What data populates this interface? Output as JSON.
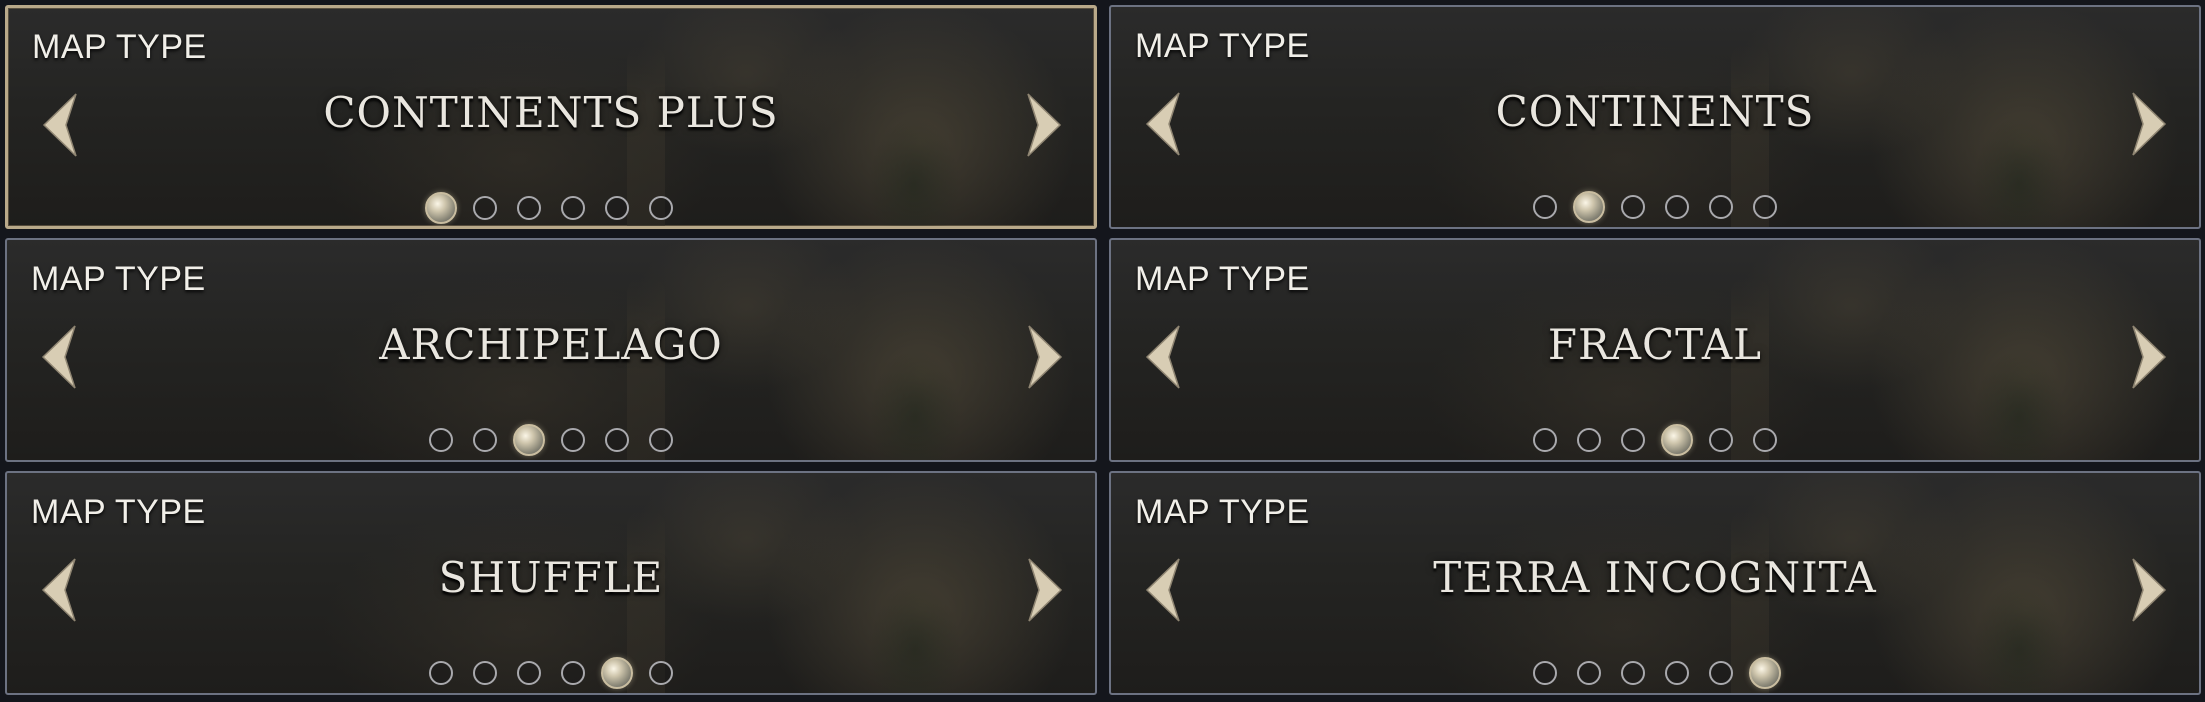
{
  "panels": [
    {
      "label": "MAP TYPE",
      "value": "CONTINENTS PLUS",
      "selected": true,
      "active_index": 0,
      "option_count": 6
    },
    {
      "label": "MAP TYPE",
      "value": "CONTINENTS",
      "selected": false,
      "active_index": 1,
      "option_count": 6
    },
    {
      "label": "MAP TYPE",
      "value": "ARCHIPELAGO",
      "selected": false,
      "active_index": 2,
      "option_count": 6
    },
    {
      "label": "MAP TYPE",
      "value": "FRACTAL",
      "selected": false,
      "active_index": 3,
      "option_count": 6
    },
    {
      "label": "MAP TYPE",
      "value": "SHUFFLE",
      "selected": false,
      "active_index": 4,
      "option_count": 6
    },
    {
      "label": "MAP TYPE",
      "value": "TERRA INCOGNITA",
      "selected": false,
      "active_index": 5,
      "option_count": 6
    }
  ],
  "icons": {
    "prev": "chevron-left-icon",
    "next": "chevron-right-icon"
  },
  "colors": {
    "selected_border": "#b9a98a",
    "border": "#6c7282",
    "text": "#e9e6df"
  }
}
